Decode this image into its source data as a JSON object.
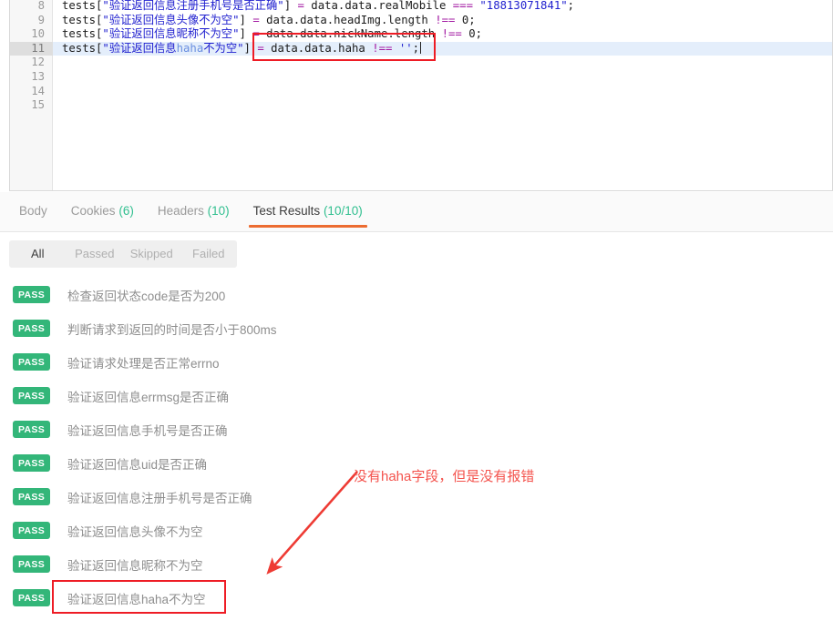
{
  "editor": {
    "lines": [
      {
        "number": "8",
        "active": false,
        "tokens": [
          {
            "t": "tests[",
            "c": "id"
          },
          {
            "t": "\"验证返回信息注册手机号是否正确\"",
            "c": "str"
          },
          {
            "t": "] ",
            "c": "id"
          },
          {
            "t": "=",
            "c": "op"
          },
          {
            "t": " data.data.realMobile ",
            "c": "id"
          },
          {
            "t": "===",
            "c": "op"
          },
          {
            "t": " ",
            "c": "id"
          },
          {
            "t": "\"18813071841\"",
            "c": "str"
          },
          {
            "t": ";",
            "c": "id"
          }
        ]
      },
      {
        "number": "9",
        "active": false,
        "tokens": [
          {
            "t": "tests[",
            "c": "id"
          },
          {
            "t": "\"验证返回信息头像不为空\"",
            "c": "str"
          },
          {
            "t": "] ",
            "c": "id"
          },
          {
            "t": "=",
            "c": "op"
          },
          {
            "t": " data.data.headImg.length ",
            "c": "id"
          },
          {
            "t": "!==",
            "c": "op"
          },
          {
            "t": " ",
            "c": "id"
          },
          {
            "t": "0",
            "c": "num"
          },
          {
            "t": ";",
            "c": "id"
          }
        ]
      },
      {
        "number": "10",
        "active": false,
        "tokens": [
          {
            "t": "tests[",
            "c": "id"
          },
          {
            "t": "\"验证返回信息昵称不为空\"",
            "c": "str"
          },
          {
            "t": "] ",
            "c": "id"
          },
          {
            "t": "=",
            "c": "op"
          },
          {
            "t": " data.data.nickName.length ",
            "c": "id"
          },
          {
            "t": "!==",
            "c": "op"
          },
          {
            "t": " ",
            "c": "id"
          },
          {
            "t": "0",
            "c": "num"
          },
          {
            "t": ";",
            "c": "id"
          }
        ]
      },
      {
        "number": "11",
        "active": true,
        "caret": true,
        "tokens": [
          {
            "t": "tests[",
            "c": "id"
          },
          {
            "t": "\"验证返回信息",
            "c": "str"
          },
          {
            "t": "haha",
            "c": "haha"
          },
          {
            "t": "不为空\"",
            "c": "str"
          },
          {
            "t": "] ",
            "c": "id"
          },
          {
            "t": "=",
            "c": "op"
          },
          {
            "t": " data.data.haha ",
            "c": "id"
          },
          {
            "t": "!==",
            "c": "op"
          },
          {
            "t": " ",
            "c": "id"
          },
          {
            "t": "''",
            "c": "str"
          },
          {
            "t": ";",
            "c": "id"
          }
        ]
      },
      {
        "number": "12",
        "active": false,
        "tokens": []
      },
      {
        "number": "13",
        "active": false,
        "tokens": []
      },
      {
        "number": "14",
        "active": false,
        "tokens": []
      },
      {
        "number": "15",
        "active": false,
        "tokens": []
      }
    ]
  },
  "tabs": [
    {
      "label": "Body",
      "count": "",
      "active": false
    },
    {
      "label": "Cookies",
      "count": "(6)",
      "active": false
    },
    {
      "label": "Headers",
      "count": "(10)",
      "active": false
    },
    {
      "label": "Test Results",
      "count": "(10/10)",
      "active": true
    }
  ],
  "filters": [
    {
      "label": "All",
      "active": true
    },
    {
      "label": "Passed",
      "active": false
    },
    {
      "label": "Skipped",
      "active": false
    },
    {
      "label": "Failed",
      "active": false
    }
  ],
  "results": [
    {
      "status": "PASS",
      "label": "检查返回状态code是否为200"
    },
    {
      "status": "PASS",
      "label": "判断请求到返回的时间是否小于800ms"
    },
    {
      "status": "PASS",
      "label": "验证请求处理是否正常errno"
    },
    {
      "status": "PASS",
      "label": "验证返回信息errmsg是否正确"
    },
    {
      "status": "PASS",
      "label": "验证返回信息手机号是否正确"
    },
    {
      "status": "PASS",
      "label": "验证返回信息uid是否正确"
    },
    {
      "status": "PASS",
      "label": "验证返回信息注册手机号是否正确"
    },
    {
      "status": "PASS",
      "label": "验证返回信息头像不为空"
    },
    {
      "status": "PASS",
      "label": "验证返回信息昵称不为空"
    },
    {
      "status": "PASS",
      "label": "验证返回信息haha不为空"
    }
  ],
  "annotations": {
    "note_text": "没有haha字段，但是没有报错",
    "note_color": "#f4534d",
    "box_color": "#ee1c25"
  }
}
